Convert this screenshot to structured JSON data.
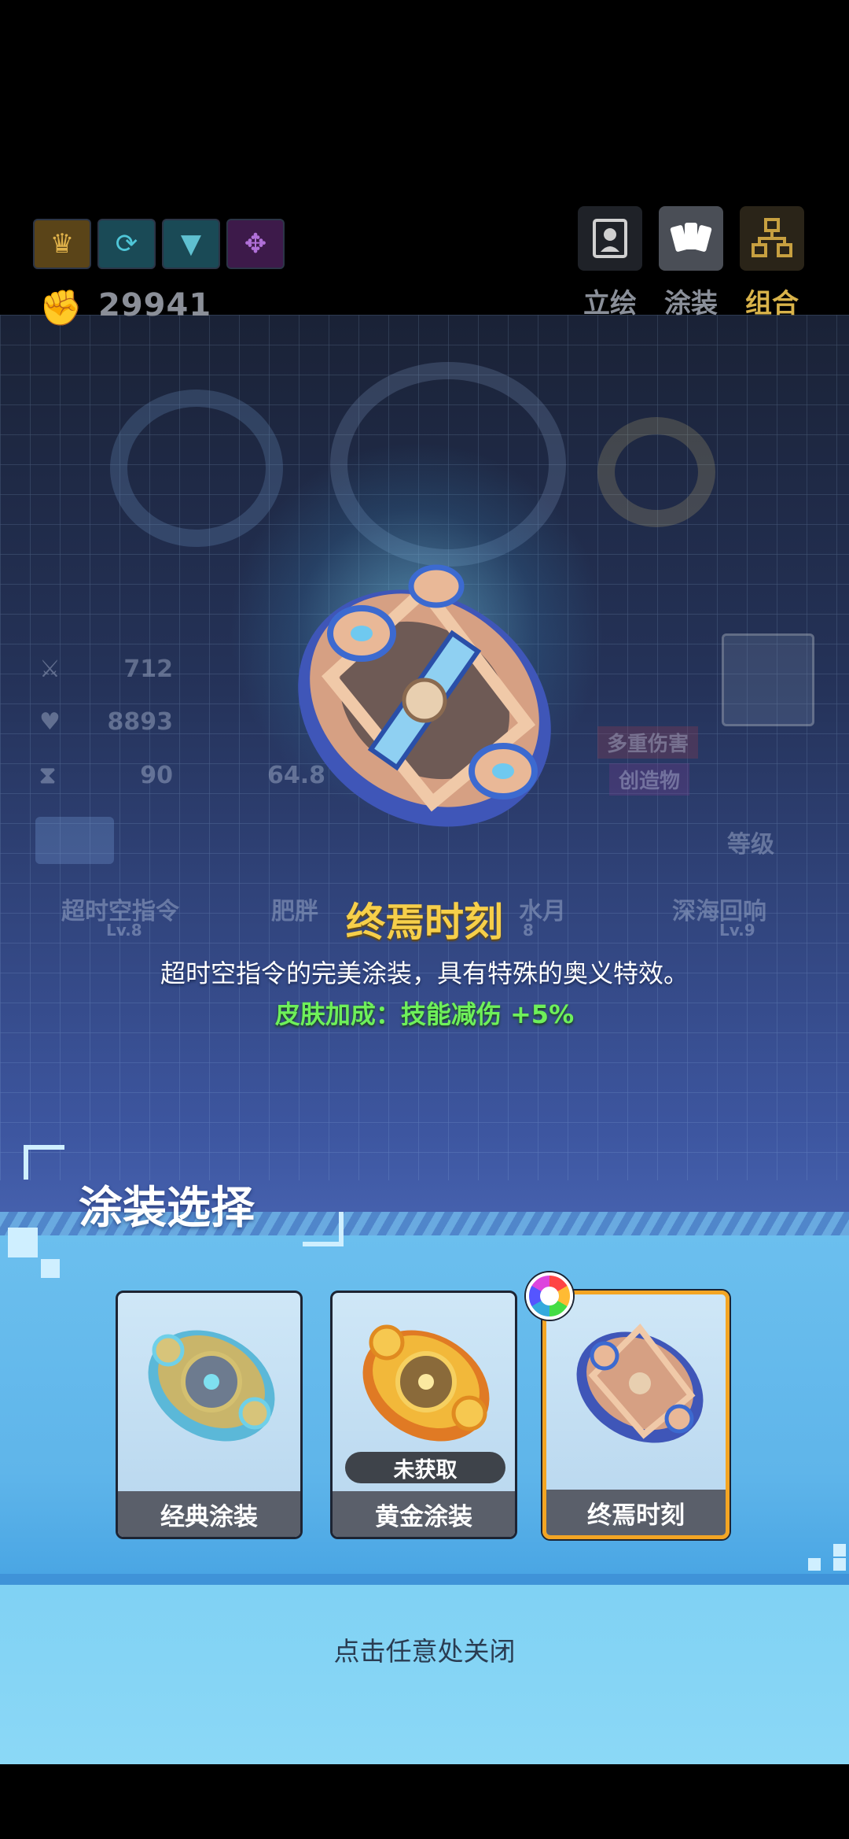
{
  "header": {
    "power_value": "29941",
    "tabs": [
      {
        "label": "立绘",
        "color": "#8a8f99"
      },
      {
        "label": "涂装",
        "color": "#8a8f99"
      },
      {
        "label": "组合",
        "color": "#d9b34a"
      }
    ]
  },
  "background": {
    "stats": [
      "712",
      "8893",
      "90",
      "64.8"
    ],
    "tags": [
      "多重伤害",
      "创造物"
    ],
    "grade_label": "等级",
    "team": [
      {
        "name": "超时空指令",
        "level": "Lv.8"
      },
      {
        "name": "肥胖",
        "level": ""
      },
      {
        "name": "水月",
        "level": "8"
      },
      {
        "name": "深海回响",
        "level": "Lv.9"
      }
    ]
  },
  "skin": {
    "title": "终焉时刻",
    "description": "超时空指令的完美涂装，具有特殊的奥义特效。",
    "bonus": "皮肤加成：技能减伤 +5%"
  },
  "selection": {
    "title": "涂装选择",
    "cards": [
      {
        "label": "经典涂装",
        "status": ""
      },
      {
        "label": "黄金涂装",
        "status": "未获取"
      },
      {
        "label": "终焉时刻",
        "status": ""
      }
    ]
  },
  "footer": {
    "close_hint": "点击任意处关闭"
  },
  "colors": {
    "title_gold": "#f6cf4a",
    "bonus_green": "#6ef05a",
    "selected_border": "#f3a523",
    "panel_blue": "#5fb5ea"
  }
}
